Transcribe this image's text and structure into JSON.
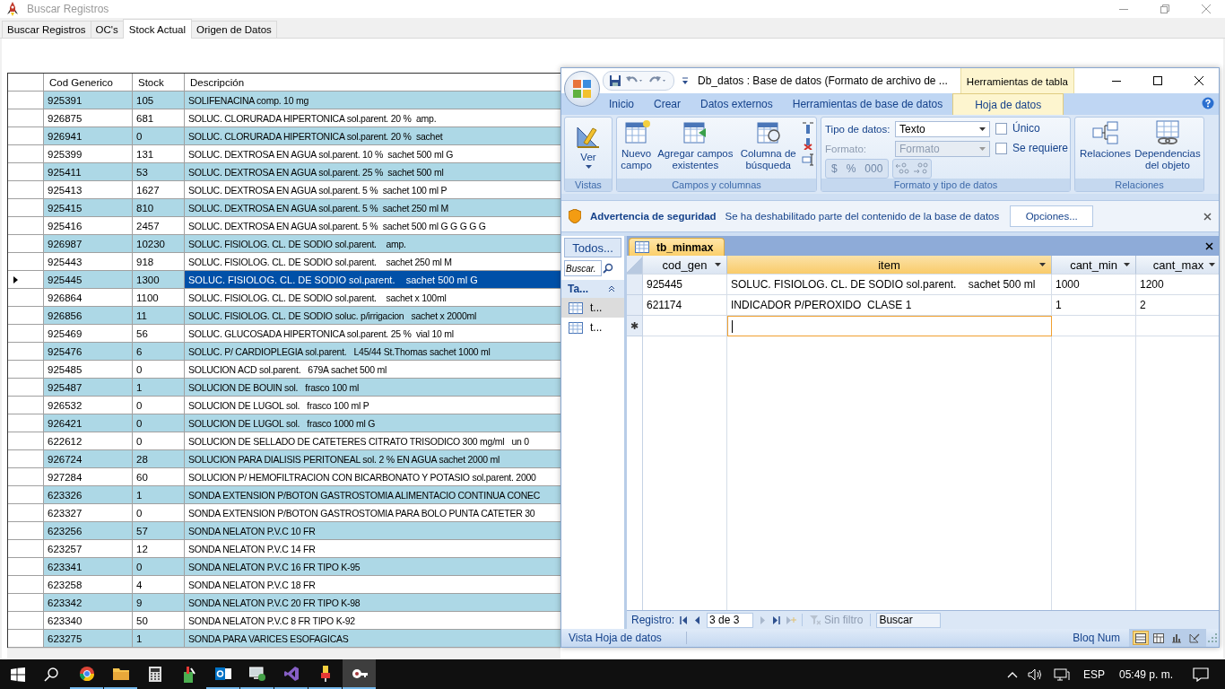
{
  "main_window": {
    "title": "Buscar Registros",
    "tabs": [
      {
        "label": "Buscar Registros",
        "selected": false
      },
      {
        "label": "OC's",
        "selected": false
      },
      {
        "label": "Stock Actual",
        "selected": true
      },
      {
        "label": "Origen de Datos",
        "selected": false
      }
    ],
    "grid": {
      "columns": [
        "Cod Generico",
        "Stock",
        "Descripción"
      ],
      "rows": [
        {
          "cod": "925391",
          "stock": "105",
          "desc": "SOLIFENACINA comp. 10 mg",
          "selected": false
        },
        {
          "cod": "926875",
          "stock": "681",
          "desc": "SOLUC. CLORURADA HIPERTONICA sol.parent. 20 %  amp.",
          "selected": false
        },
        {
          "cod": "926941",
          "stock": "0",
          "desc": "SOLUC. CLORURADA HIPERTONICA sol.parent. 20 %  sachet",
          "selected": false
        },
        {
          "cod": "925399",
          "stock": "131",
          "desc": "SOLUC. DEXTROSA EN AGUA sol.parent. 10 %  sachet 500 ml G",
          "selected": false
        },
        {
          "cod": "925411",
          "stock": "53",
          "desc": "SOLUC. DEXTROSA EN AGUA sol.parent. 25 %  sachet 500 ml",
          "selected": false
        },
        {
          "cod": "925413",
          "stock": "1627",
          "desc": "SOLUC. DEXTROSA EN AGUA sol.parent. 5 %  sachet 100 ml P",
          "selected": false
        },
        {
          "cod": "925415",
          "stock": "810",
          "desc": "SOLUC. DEXTROSA EN AGUA sol.parent. 5 %  sachet 250 ml M",
          "selected": false
        },
        {
          "cod": "925416",
          "stock": "2457",
          "desc": "SOLUC. DEXTROSA EN AGUA sol.parent. 5 %  sachet 500 ml G G G G G",
          "selected": false
        },
        {
          "cod": "926987",
          "stock": "10230",
          "desc": "SOLUC. FISIOLOG. CL. DE SODIO sol.parent.    amp.",
          "selected": false
        },
        {
          "cod": "925443",
          "stock": "918",
          "desc": "SOLUC. FISIOLOG. CL. DE SODIO sol.parent.    sachet 250 ml M",
          "selected": false
        },
        {
          "cod": "925445",
          "stock": "1300",
          "desc": "SOLUC. FISIOLOG. CL. DE SODIO sol.parent.    sachet 500 ml G",
          "selected": true
        },
        {
          "cod": "926864",
          "stock": "1100",
          "desc": "SOLUC. FISIOLOG. CL. DE SODIO sol.parent.    sachet x 100ml",
          "selected": false
        },
        {
          "cod": "926856",
          "stock": "11",
          "desc": "SOLUC. FISIOLOG. CL. DE SODIO soluc. p/irrigacion   sachet x 2000ml",
          "selected": false
        },
        {
          "cod": "925469",
          "stock": "56",
          "desc": "SOLUC. GLUCOSADA HIPERTONICA sol.parent. 25 %  vial 10 ml",
          "selected": false
        },
        {
          "cod": "925476",
          "stock": "6",
          "desc": "SOLUC. P/ CARDIOPLEGIA sol.parent.   L45/44 St.Thomas sachet 1000 ml",
          "selected": false
        },
        {
          "cod": "925485",
          "stock": "0",
          "desc": "SOLUCION ACD sol.parent.   679A sachet 500 ml",
          "selected": false
        },
        {
          "cod": "925487",
          "stock": "1",
          "desc": "SOLUCION DE BOUIN sol.   frasco 100 ml",
          "selected": false
        },
        {
          "cod": "926532",
          "stock": "0",
          "desc": "SOLUCION DE LUGOL sol.   frasco 100 ml P",
          "selected": false
        },
        {
          "cod": "926421",
          "stock": "0",
          "desc": "SOLUCION DE LUGOL sol.   frasco 1000 ml G",
          "selected": false
        },
        {
          "cod": "622612",
          "stock": "0",
          "desc": "SOLUCION DE SELLADO DE CATETERES CITRATO TRISODICO 300 mg/ml   un 0",
          "selected": false
        },
        {
          "cod": "926724",
          "stock": "28",
          "desc": "SOLUCION PARA DIALISIS PERITONEAL sol. 2 % EN AGUA sachet 2000 ml",
          "selected": false
        },
        {
          "cod": "927284",
          "stock": "60",
          "desc": "SOLUCION P/ HEMOFILTRACION CON BICARBONATO Y POTASIO sol.parent. 2000",
          "selected": false
        },
        {
          "cod": "623326",
          "stock": "1",
          "desc": "SONDA EXTENSION P/BOTON GASTROSTOMIA ALIMENTACIO CONTINUA CONEC",
          "selected": false
        },
        {
          "cod": "623327",
          "stock": "0",
          "desc": "SONDA EXTENSION P/BOTON GASTROSTOMIA PARA BOLO PUNTA CATETER 30",
          "selected": false
        },
        {
          "cod": "623256",
          "stock": "57",
          "desc": "SONDA NELATON P.V.C 10 FR",
          "selected": false
        },
        {
          "cod": "623257",
          "stock": "12",
          "desc": "SONDA NELATON P.V.C 14 FR",
          "selected": false
        },
        {
          "cod": "623341",
          "stock": "0",
          "desc": "SONDA NELATON P.V.C 16 FR TIPO K-95",
          "selected": false
        },
        {
          "cod": "623258",
          "stock": "4",
          "desc": "SONDA NELATON P.V.C 18 FR",
          "selected": false
        },
        {
          "cod": "623342",
          "stock": "9",
          "desc": "SONDA NELATON P.V.C 20 FR TIPO K-98",
          "selected": false
        },
        {
          "cod": "623340",
          "stock": "50",
          "desc": "SONDA NELATON P.V.C 8 FR TIPO K-92",
          "selected": false
        },
        {
          "cod": "623275",
          "stock": "1",
          "desc": "SONDA PARA VARICES ESOFAGICAS",
          "selected": false
        }
      ]
    }
  },
  "access_window": {
    "title": "Db_datos : Base de datos (Formato de archivo de ...",
    "context_tab": "Herramientas de tabla",
    "ribbon_tabs": [
      {
        "label": "Inicio",
        "selected": false
      },
      {
        "label": "Crear",
        "selected": false
      },
      {
        "label": "Datos externos",
        "selected": false
      },
      {
        "label": "Herramientas de base de datos",
        "selected": false
      },
      {
        "label": "Hoja de datos",
        "selected": true
      }
    ],
    "ribbon": {
      "vistas": {
        "label": "Vistas",
        "button": "Ver"
      },
      "campos": {
        "label": "Campos y columnas",
        "buttons": [
          "Nuevo campo",
          "Agregar campos existentes",
          "Columna de búsqueda"
        ]
      },
      "formato": {
        "label": "Formato y tipo de datos",
        "data_type_label": "Tipo de datos:",
        "data_type_value": "Texto",
        "format_label": "Formato:",
        "format_value": "Formato",
        "format_disabled": true,
        "symbols": [
          "$",
          "%",
          "000"
        ],
        "checkboxes": [
          {
            "label": "Único",
            "checked": false
          },
          {
            "label": "Se requiere",
            "checked": false
          }
        ]
      },
      "relaciones": {
        "label": "Relaciones",
        "buttons": [
          "Relaciones",
          "Dependencias del objeto"
        ]
      }
    },
    "security_bar": {
      "title": "Advertencia de seguridad",
      "message": "Se ha deshabilitado parte del contenido de la base de datos",
      "button": "Opciones..."
    },
    "nav_pane": {
      "header": "Todos...",
      "search_placeholder": "Buscar.",
      "group": "Ta...",
      "items": [
        {
          "label": "t...",
          "selected": true
        },
        {
          "label": "t...",
          "selected": false
        }
      ]
    },
    "datasheet": {
      "tab": "tb_minmax",
      "columns": [
        {
          "label": "cod_gen",
          "selected": false
        },
        {
          "label": "item",
          "selected": true
        },
        {
          "label": "cant_min",
          "selected": false
        },
        {
          "label": "cant_max",
          "selected": false
        }
      ],
      "rows": [
        [
          "925445",
          "SOLUC. FISIOLOG. CL. DE SODIO sol.parent.    sachet 500 ml",
          "1000",
          "1200"
        ],
        [
          "621174",
          "INDICADOR P/PEROXIDO  CLASE 1",
          "1",
          "2"
        ]
      ],
      "new_row_marker": "✱"
    },
    "record_nav": {
      "label": "Registro:",
      "position": "3 de 3",
      "filter": "Sin filtro",
      "search_placeholder": "Buscar"
    },
    "status_bar": {
      "view": "Vista Hoja de datos",
      "num_lock": "Bloq Num",
      "views": [
        {
          "kind": "datasheet",
          "selected": true
        },
        {
          "kind": "pivot_table",
          "selected": false
        },
        {
          "kind": "pivot_chart",
          "selected": false
        },
        {
          "kind": "design",
          "selected": false
        }
      ]
    }
  },
  "taskbar": {
    "apps": [
      {
        "kind": "browser",
        "running": true,
        "active": false
      },
      {
        "kind": "folder",
        "running": true,
        "active": false
      },
      {
        "kind": "calculator",
        "running": false,
        "active": false
      },
      {
        "kind": "tool",
        "running": false,
        "active": false
      },
      {
        "kind": "mail",
        "running": true,
        "active": false
      },
      {
        "kind": "monitor",
        "running": true,
        "active": false
      },
      {
        "kind": "studio",
        "running": true,
        "active": false
      },
      {
        "kind": "usb",
        "running": true,
        "active": false
      },
      {
        "kind": "access",
        "running": true,
        "active": true
      }
    ],
    "language": "ESP",
    "time": "05:49 p. m."
  }
}
